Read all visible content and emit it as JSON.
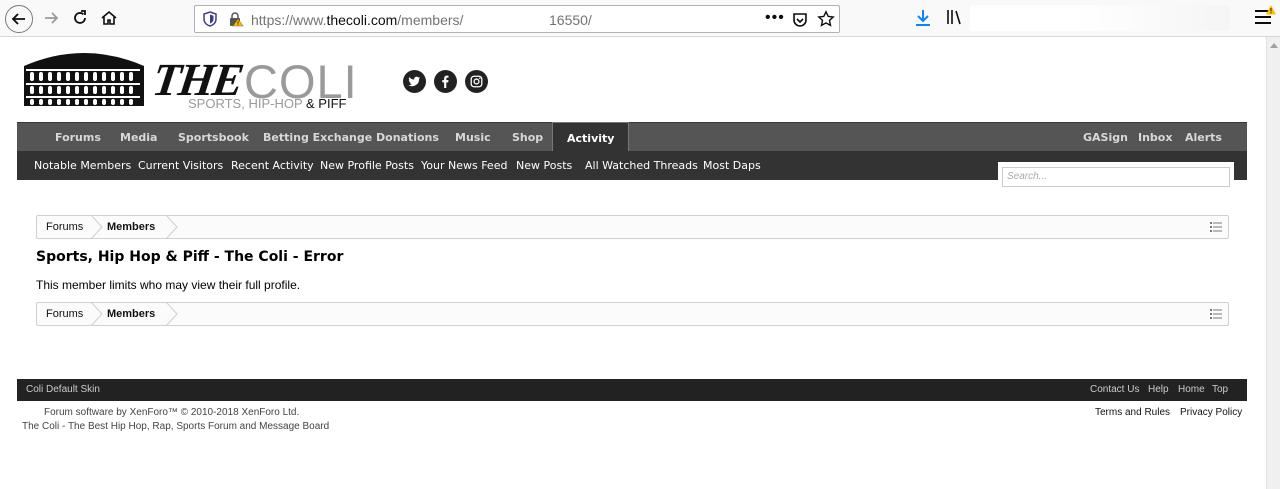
{
  "browser": {
    "url_prefix": "https://www.",
    "url_host": "thecoli.com",
    "url_path": "/members/",
    "url_id": "16550/",
    "more_label": "•••"
  },
  "site": {
    "logo_the": "THE",
    "logo_coli": "COLI",
    "tagline_main": "SPORTS, HIP-HOP ",
    "tagline_piff": "& PIFF"
  },
  "nav": {
    "tabs": [
      {
        "label": "Forums"
      },
      {
        "label": "Media"
      },
      {
        "label": "Sportsbook"
      },
      {
        "label": "Betting Exchange"
      },
      {
        "label": "Donations"
      },
      {
        "label": "Music"
      },
      {
        "label": "Shop"
      },
      {
        "label": "Activity"
      }
    ],
    "right": [
      {
        "label": "GASign"
      },
      {
        "label": "Inbox"
      },
      {
        "label": "Alerts"
      }
    ],
    "sub": [
      {
        "label": "Notable Members"
      },
      {
        "label": "Current Visitors"
      },
      {
        "label": "Recent Activity"
      },
      {
        "label": "New Profile Posts"
      },
      {
        "label": "Your News Feed"
      },
      {
        "label": "New Posts"
      },
      {
        "label": "All Watched Threads"
      },
      {
        "label": "Most Daps"
      }
    ],
    "search_placeholder": "Search..."
  },
  "breadcrumb": {
    "items": [
      {
        "label": "Forums"
      },
      {
        "label": "Members"
      }
    ]
  },
  "main": {
    "title": "Sports, Hip Hop & Piff - The Coli - Error",
    "message": "This member limits who may view their full profile."
  },
  "footer": {
    "skin": "Coli Default Skin",
    "links": [
      {
        "label": "Contact Us"
      },
      {
        "label": "Help"
      },
      {
        "label": "Home"
      },
      {
        "label": "Top"
      }
    ],
    "legal": [
      {
        "label": "Terms and Rules"
      },
      {
        "label": "Privacy Policy"
      }
    ],
    "copyright": "Forum software by XenForo™ © 2010-2018 XenForo Ltd.",
    "description": "The Coli - The Best Hip Hop, Rap, Sports Forum and Message Board"
  },
  "colors": {
    "nav_bg": "#555555",
    "subnav_bg": "#333333",
    "footer_bg": "#222222",
    "download_accent": "#0a84ff"
  }
}
